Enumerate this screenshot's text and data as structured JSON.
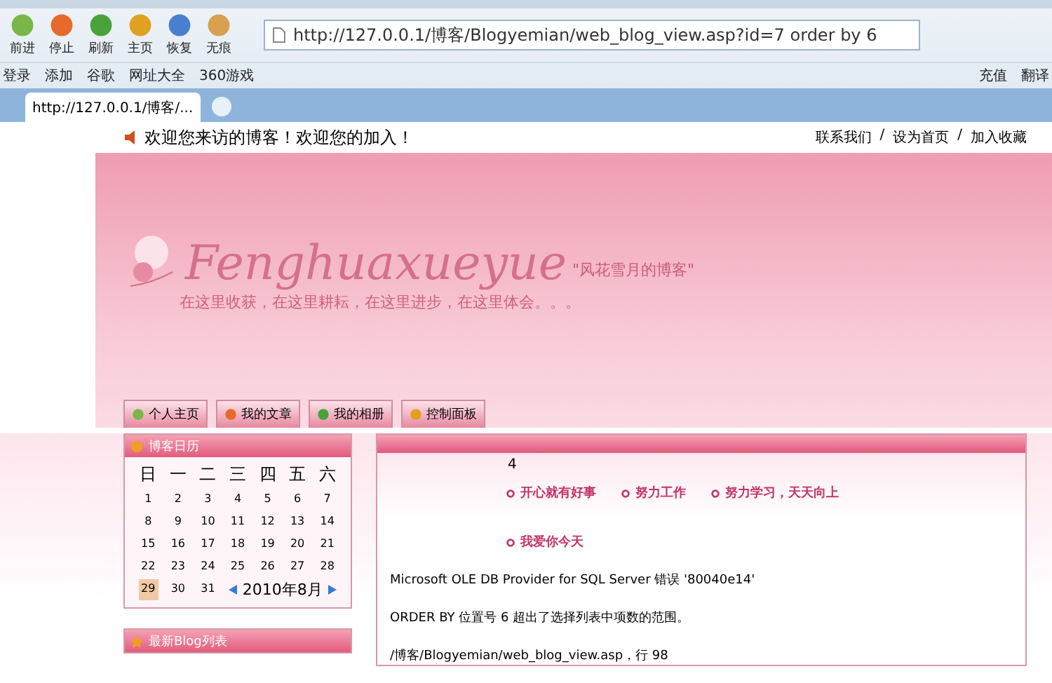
{
  "browser": {
    "toolbar": [
      "前进",
      "停止",
      "刷新",
      "主页",
      "恢复",
      "无痕"
    ],
    "address": "http://127.0.0.1/博客/Blogyemian/web_blog_view.asp?id=7 order by 6",
    "bookmarks": [
      "登录",
      "添加",
      "谷歌",
      "网址大全",
      "360游戏"
    ],
    "bookmarks_right": [
      "充值",
      "翻译"
    ],
    "tabs": [
      {
        "label": "http://127.0.0.1/博客/...",
        "selected": true
      }
    ]
  },
  "welcome": "欢迎您来访的博客！欢迎您的加入！",
  "top_links": [
    "联系我们",
    "设为首页",
    "加入收藏"
  ],
  "top_link_separators": [
    "/",
    "/"
  ],
  "banner": {
    "title": "Fenghuaxueyue",
    "subtitle": "\"风花雪月的博客\"",
    "slogan": "在这里收获，在这里耕耘，在这里进步，在这里体会。。。"
  },
  "nav": [
    {
      "label": "个人主页",
      "selected": false
    },
    {
      "label": "我的文章",
      "selected": false
    },
    {
      "label": "我的相册",
      "selected": false
    },
    {
      "label": "控制面板",
      "selected": false
    }
  ],
  "calendar": {
    "title": "博客日历",
    "weekdays": [
      "日",
      "一",
      "二",
      "三",
      "四",
      "五",
      "六"
    ],
    "weeks": [
      [
        {
          "day": "1",
          "selected": false
        },
        {
          "day": "2",
          "selected": false
        },
        {
          "day": "3",
          "selected": false
        },
        {
          "day": "4",
          "selected": false
        },
        {
          "day": "5",
          "selected": false
        },
        {
          "day": "6",
          "selected": false
        },
        {
          "day": "7",
          "selected": false
        }
      ],
      [
        {
          "day": "8",
          "selected": false
        },
        {
          "day": "9",
          "selected": false
        },
        {
          "day": "10",
          "selected": false
        },
        {
          "day": "11",
          "selected": false
        },
        {
          "day": "12",
          "selected": false
        },
        {
          "day": "13",
          "selected": false
        },
        {
          "day": "14",
          "selected": false
        }
      ],
      [
        {
          "day": "15",
          "selected": false
        },
        {
          "day": "16",
          "selected": false
        },
        {
          "day": "17",
          "selected": false
        },
        {
          "day": "18",
          "selected": false
        },
        {
          "day": "19",
          "selected": false
        },
        {
          "day": "20",
          "selected": false
        },
        {
          "day": "21",
          "selected": false
        }
      ],
      [
        {
          "day": "22",
          "selected": false
        },
        {
          "day": "23",
          "selected": false
        },
        {
          "day": "24",
          "selected": false
        },
        {
          "day": "25",
          "selected": false
        },
        {
          "day": "26",
          "selected": false
        },
        {
          "day": "27",
          "selected": false
        },
        {
          "day": "28",
          "selected": false
        }
      ],
      [
        {
          "day": "29",
          "selected": true
        },
        {
          "day": "30",
          "selected": false
        },
        {
          "day": "31",
          "selected": false
        }
      ]
    ],
    "month": "2010年8月"
  },
  "latest": {
    "title": "最新Blog列表"
  },
  "content": {
    "number": "4",
    "links": [
      "开心就有好事",
      "努力工作",
      "努力学习，天天向上",
      "我爱你今天"
    ],
    "errors": [
      "Microsoft OLE DB Provider for SQL Server  错误 '80040e14'",
      "ORDER BY 位置号 6 超出了选择列表中项数的范围。",
      "/博客/Blogyemian/web_blog_view.asp，行 98"
    ]
  }
}
